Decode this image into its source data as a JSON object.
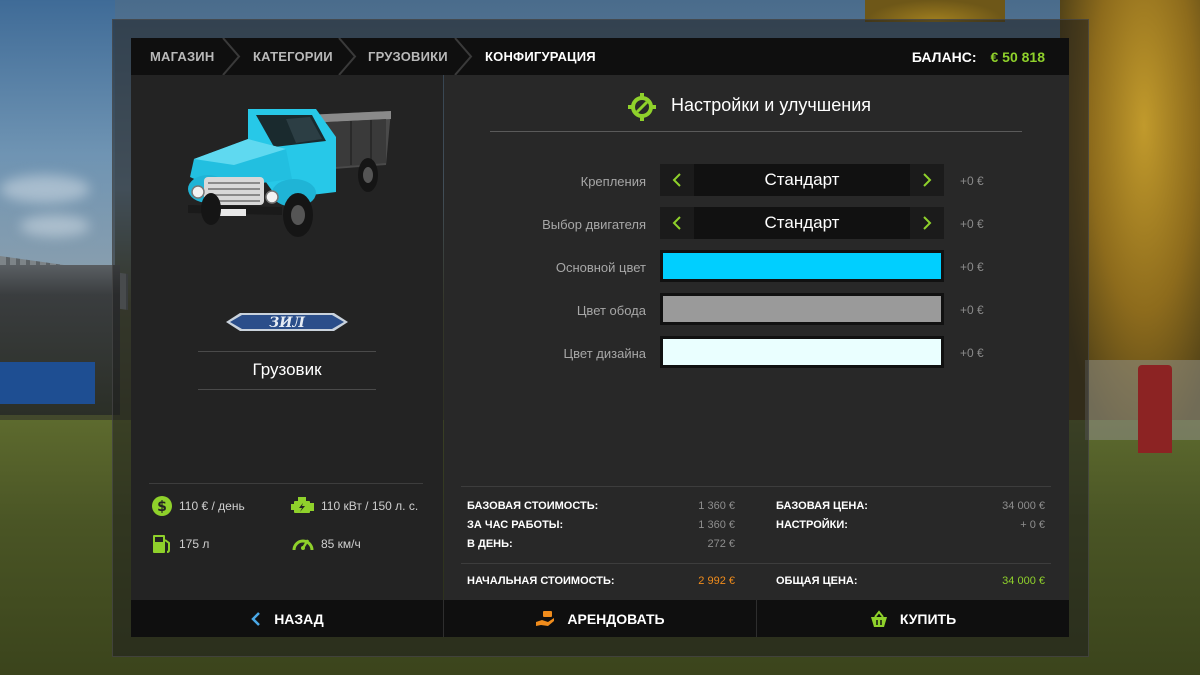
{
  "breadcrumb": [
    "МАГАЗИН",
    "КАТЕГОРИИ",
    "ГРУЗОВИКИ",
    "КОНФИГУРАЦИЯ"
  ],
  "balance": {
    "label": "БАЛАНС:",
    "value": "€ 50 818"
  },
  "vehicle": {
    "name": "Грузовик",
    "brand_logo_text": "ЗИЛ",
    "body_color": "#27c8e8",
    "stats": {
      "cost_per_day": "110 € / день",
      "power": "110 кВт / 150 л. с.",
      "fuel": "175 л",
      "speed": "85 км/ч"
    }
  },
  "settings": {
    "title": "Настройки и улучшения",
    "rows": [
      {
        "label": "Крепления",
        "value": "Стандарт",
        "price": "+0 €"
      },
      {
        "label": "Выбор двигателя",
        "value": "Стандарт",
        "price": "+0 €"
      },
      {
        "label": "Основной цвет",
        "color": "#00cfff",
        "price": "+0 €"
      },
      {
        "label": "Цвет обода",
        "color": "#9a9a9a",
        "price": "+0 €"
      },
      {
        "label": "Цвет дизайна",
        "color": "#eaffff",
        "price": "+0 €"
      }
    ]
  },
  "costs": {
    "base_cost_label": "БАЗОВАЯ СТОИМОСТЬ:",
    "base_cost": "1 360 €",
    "per_hour_label": "ЗА ЧАС РАБОТЫ:",
    "per_hour": "1 360 €",
    "per_day_label": "В ДЕНЬ:",
    "per_day": "272 €",
    "initial_cost_label": "НАЧАЛЬНАЯ СТОИМОСТЬ:",
    "initial_cost": "2 992 €",
    "base_price_label": "БАЗОВАЯ ЦЕНА:",
    "base_price": "34 000 €",
    "settings_label": "НАСТРОЙКИ:",
    "settings_price": "+ 0 €",
    "total_label": "ОБЩАЯ ЦЕНА:",
    "total": "34 000 €"
  },
  "buttons": {
    "back": "НАЗАД",
    "lease": "АРЕНДОВАТЬ",
    "buy": "КУПИТЬ"
  },
  "colors": {
    "accent_green": "#8fd12b",
    "accent_orange": "#f08c1c",
    "accent_blue": "#4aa8e6"
  }
}
